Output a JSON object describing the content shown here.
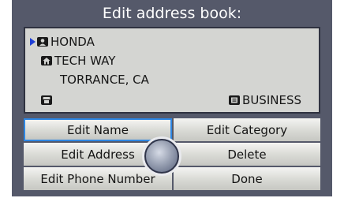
{
  "title": "Edit address book:",
  "entry": {
    "name": "HONDA",
    "street": "TECH WAY",
    "city": "TORRANCE, CA",
    "category": "BUSINESS"
  },
  "icons": {
    "selector": "arrow-right-icon",
    "name": "person-icon",
    "address": "house-icon",
    "phone": "phone-icon",
    "category": "category-icon"
  },
  "buttons": {
    "edit_name": "Edit Name",
    "edit_category": "Edit Category",
    "edit_address": "Edit Address",
    "delete": "Delete",
    "edit_phone": "Edit Phone Number",
    "done": "Done"
  },
  "colors": {
    "background": "#55596a",
    "panel": "#d4d5d2",
    "selection": "#2d86e3",
    "pointer": "#1f3fd6"
  }
}
